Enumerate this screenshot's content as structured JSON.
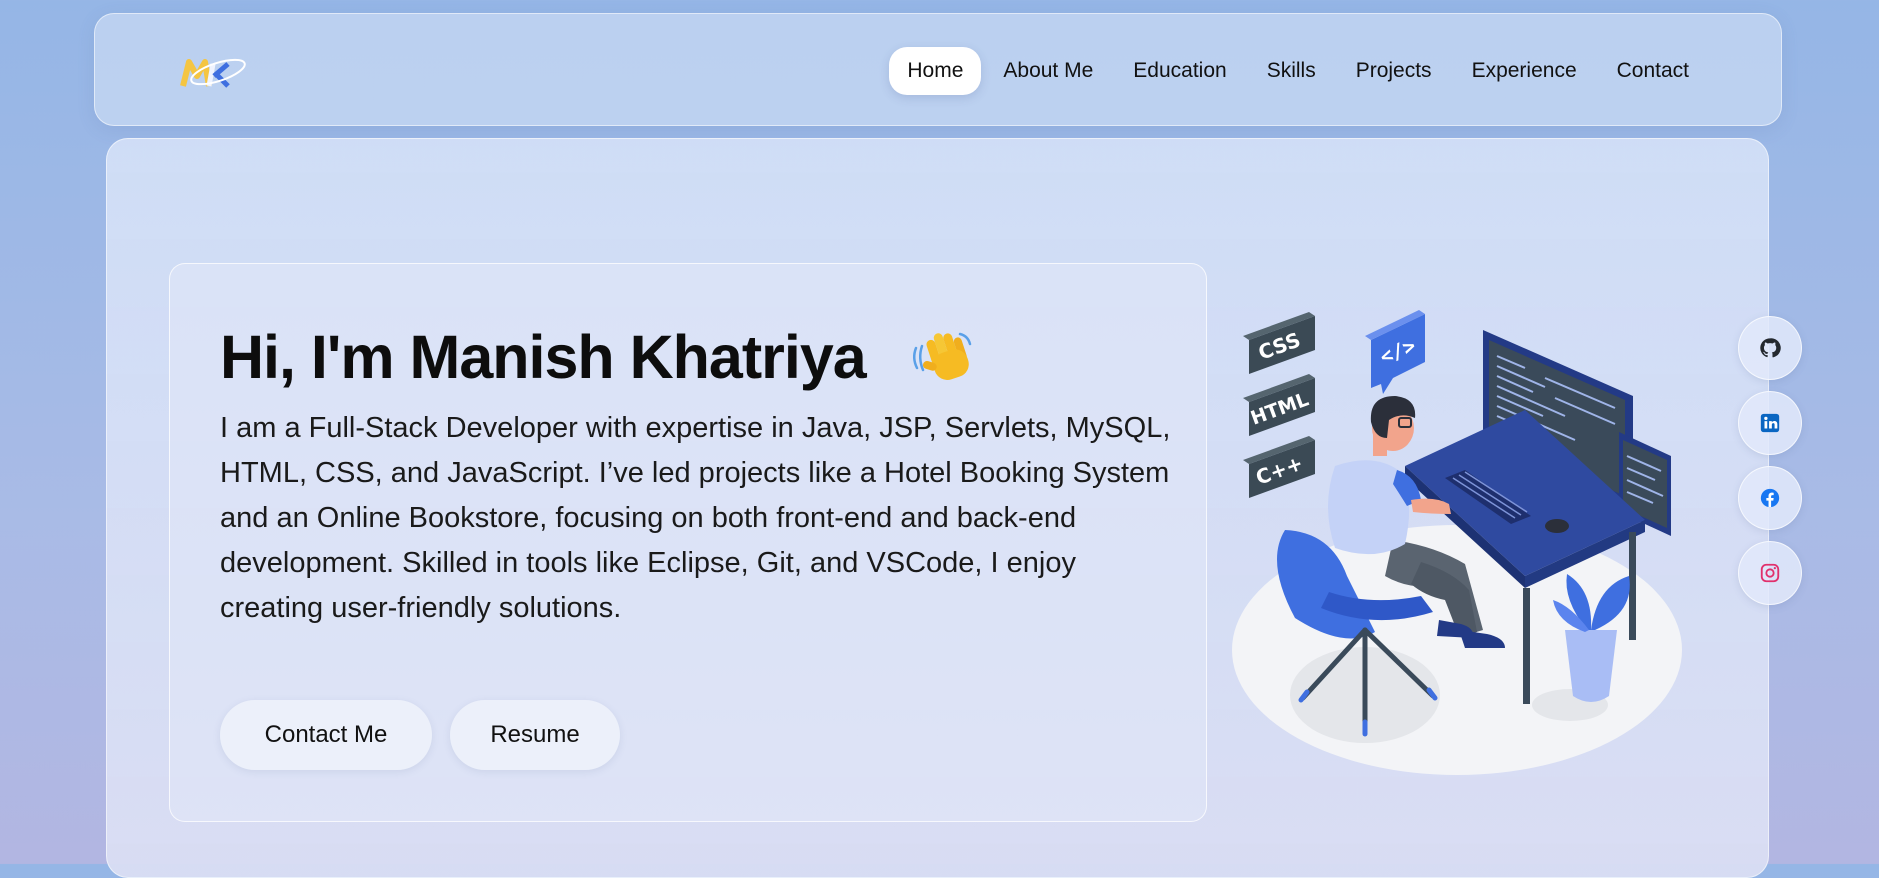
{
  "nav": {
    "logo": "logo",
    "links": [
      {
        "label": "Home",
        "active": true
      },
      {
        "label": "About Me"
      },
      {
        "label": "Education"
      },
      {
        "label": "Skills"
      },
      {
        "label": "Projects"
      },
      {
        "label": "Experience"
      },
      {
        "label": "Contact"
      }
    ]
  },
  "hero": {
    "title": "Hi, I'm Manish Khatriya",
    "description": "I am a Full-Stack Developer with expertise in Java, JSP, Servlets, MySQL, HTML, CSS, and JavaScript. I’ve led projects like a Hotel Booking System and an Online Bookstore, focusing on both front-end and back-end development. Skilled in tools like Eclipse, Git, and VSCode, I enjoy creating user-friendly solutions.",
    "buttons": {
      "contact": "Contact Me",
      "resume": "Resume"
    }
  },
  "illustration": {
    "tags": [
      "CSS",
      "HTML",
      "C++"
    ],
    "code_icon": "</>"
  },
  "social": [
    {
      "icon": "github-icon"
    },
    {
      "icon": "linkedin-icon"
    },
    {
      "icon": "facebook-icon"
    },
    {
      "icon": "instagram-icon"
    }
  ],
  "colors": {
    "accent_blue": "#3f6fe0",
    "dark_navy": "#233a86",
    "linkedin": "#0a66c2",
    "facebook": "#1877f2",
    "instagram": "#e1306c"
  }
}
